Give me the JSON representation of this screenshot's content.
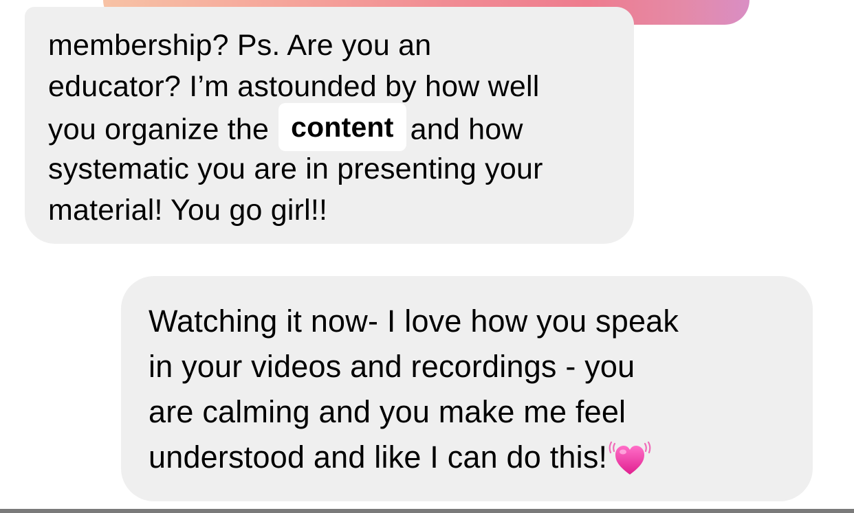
{
  "thread": {
    "top_outgoing_bubble": {
      "gradient_colors": [
        "#f7c2a5",
        "#f08a93",
        "#d98ec4"
      ]
    },
    "incoming_message": {
      "lines": [
        "membership? Ps. Are you an",
        "educator? I’m astounded by how well",
        "you organize the",
        "and how",
        "systematic you are in presenting your",
        "material! You go girl!!"
      ],
      "highlight_word": "content",
      "bubble_color": "#efefef"
    },
    "outgoing_message": {
      "lines": [
        "Watching it now- I love how you speak",
        "in your videos and recordings - you",
        "are calming and you make me feel",
        "understood and like I can do this!"
      ],
      "emoji": "beating-heart-icon",
      "bubble_color": "#efefef"
    }
  }
}
